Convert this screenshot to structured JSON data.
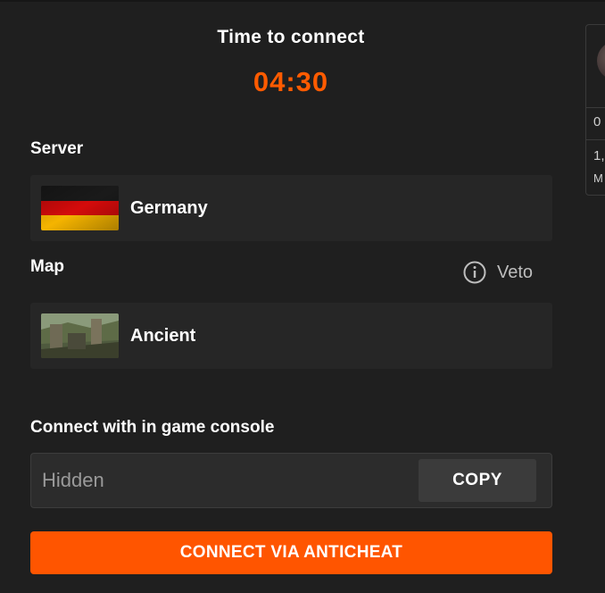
{
  "match_room": {
    "title": "Time to connect",
    "timer": "04:30",
    "server": {
      "label": "Server",
      "name": "Germany",
      "flag_icon": "germany-flag"
    },
    "map": {
      "label": "Map",
      "name": "Ancient",
      "veto_label": "Veto"
    },
    "console": {
      "label": "Connect with in game console",
      "placeholder": "Hidden",
      "copy_label": "COPY"
    },
    "connect_button_label": "CONNECT VIA ANTICHEAT",
    "accent_color": "#ff5500"
  },
  "side_panel": {
    "row1_text": "0",
    "row2_text": "1,",
    "row2_sub": "M"
  }
}
